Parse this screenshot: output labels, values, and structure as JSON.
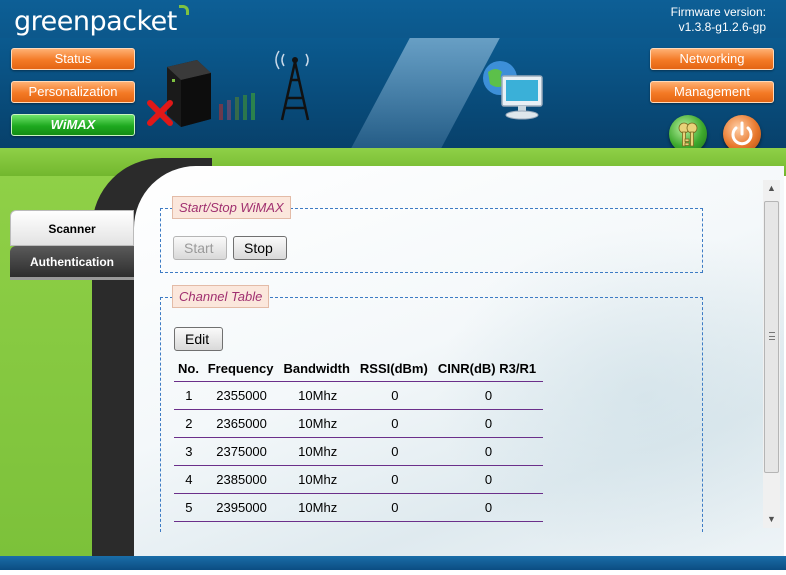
{
  "header": {
    "logo_text": "greenpacket",
    "firmware_label": "Firmware version:",
    "firmware_value": "v1.3.8-g1.2.6-gp"
  },
  "nav": {
    "left": [
      "Status",
      "Personalization",
      "WiMAX"
    ],
    "right": [
      "Networking",
      "Management"
    ],
    "active": "WiMAX"
  },
  "sidebar": {
    "tabs": [
      "Scanner",
      "Authentication"
    ],
    "active": "Scanner"
  },
  "start_stop": {
    "legend": "Start/Stop WiMAX",
    "start_label": "Start",
    "stop_label": "Stop",
    "start_enabled": false
  },
  "channel_table": {
    "legend": "Channel Table",
    "edit_label": "Edit",
    "columns": [
      "No.",
      "Frequency",
      "Bandwidth",
      "RSSI(dBm)",
      "CINR(dB) R3/R1"
    ],
    "rows": [
      [
        "1",
        "2355000",
        "10Mhz",
        "0",
        "0"
      ],
      [
        "2",
        "2365000",
        "10Mhz",
        "0",
        "0"
      ],
      [
        "3",
        "2375000",
        "10Mhz",
        "0",
        "0"
      ],
      [
        "4",
        "2385000",
        "10Mhz",
        "0",
        "0"
      ],
      [
        "5",
        "2395000",
        "10Mhz",
        "0",
        "0"
      ]
    ]
  },
  "icons": {
    "key": "key-icon",
    "power": "power-icon",
    "scroll_up": "chevron-up-icon",
    "scroll_down": "chevron-down-icon"
  },
  "colors": {
    "header_blue": "#0a4f7f",
    "green_band": "#7cc13a",
    "nav_orange": "#f47a25",
    "nav_green": "#1ea91f",
    "legend_text": "#a03070",
    "table_rule": "#6b2f8a"
  }
}
